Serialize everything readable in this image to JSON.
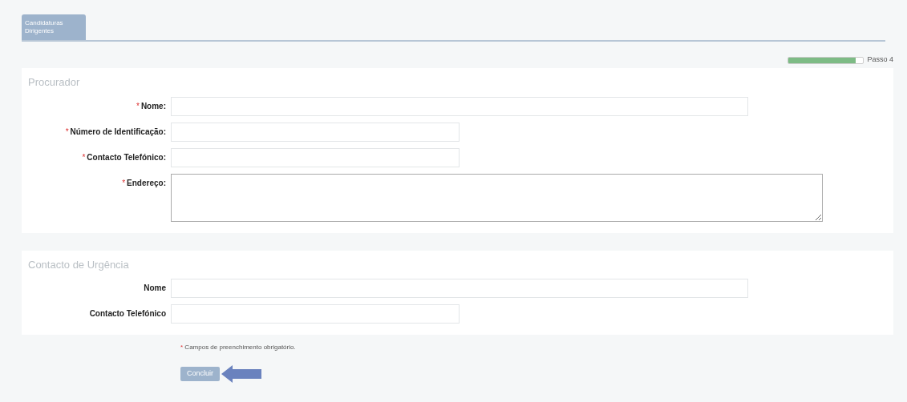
{
  "tabs": [
    {
      "label": "Candidaturas Dirigentes",
      "selected": true
    }
  ],
  "progress": {
    "level": 0.9,
    "label": "Passo 4"
  },
  "sections": [
    {
      "title": "Procurador",
      "fields": [
        {
          "label": "Nome:",
          "required": true,
          "kind": "long"
        },
        {
          "label": "Número de Identificação:",
          "required": true,
          "kind": "short"
        },
        {
          "label": "Contacto Telefónico:",
          "required": true,
          "kind": "short"
        },
        {
          "label": "Endereço:",
          "required": true,
          "kind": "textarea"
        }
      ]
    },
    {
      "title": "Contacto de Urgência",
      "fields": [
        {
          "label": "Nome",
          "required": false,
          "kind": "long"
        },
        {
          "label": "Contacto Telefónico",
          "required": false,
          "kind": "short"
        }
      ]
    }
  ],
  "note": {
    "mark": "*",
    "text": "Campos de preenchimento obrigatório."
  },
  "button": "Concluir"
}
